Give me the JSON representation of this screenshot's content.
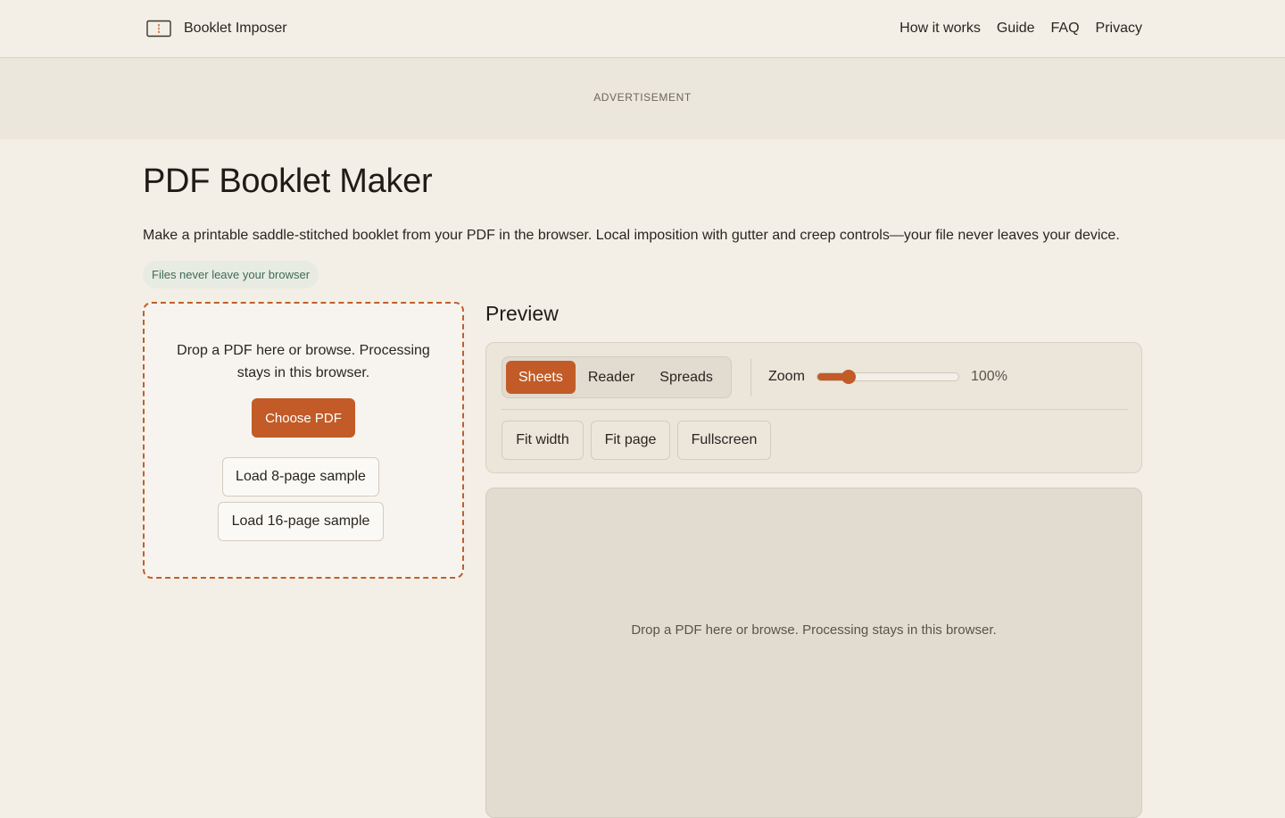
{
  "header": {
    "brand_name": "Booklet Imposer",
    "nav": [
      "How it works",
      "Guide",
      "FAQ",
      "Privacy"
    ]
  },
  "ad": {
    "label": "ADVERTISEMENT"
  },
  "main": {
    "title": "PDF Booklet Maker",
    "description": "Make a printable saddle-stitched booklet from your PDF in the browser. Local imposition with gutter and creep controls—your file never leaves your device.",
    "privacy_badge": "Files never leave your browser"
  },
  "dropzone": {
    "text": "Drop a PDF here or browse. Processing stays in this browser.",
    "choose_button": "Choose PDF",
    "sample_8": "Load 8-page sample",
    "sample_16": "Load 16-page sample"
  },
  "preview": {
    "heading": "Preview",
    "modes": [
      "Sheets",
      "Reader",
      "Spreads"
    ],
    "active_mode": "Sheets",
    "zoom_label": "Zoom",
    "zoom_value": "100%",
    "zoom_fraction": 0.22,
    "fit_width": "Fit width",
    "fit_page": "Fit page",
    "fullscreen": "Fullscreen",
    "empty_message": "Drop a PDF here or browse. Processing stays in this browser."
  },
  "colors": {
    "accent": "#c25b27",
    "background": "#f3efe6",
    "badge_bg": "#e8ebe2",
    "badge_text": "#3f6b55"
  },
  "icons": {
    "brand": "booklet-icon"
  }
}
